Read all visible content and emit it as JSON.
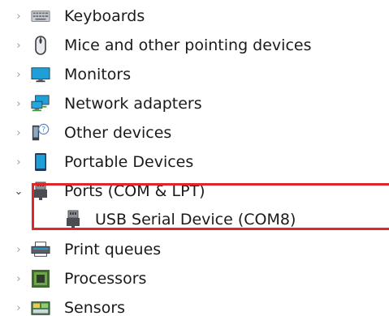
{
  "tree": {
    "items": [
      {
        "label": "Keyboards",
        "icon": "keyboard-icon",
        "toggle": "›",
        "state": "collapsed"
      },
      {
        "label": "Mice and other pointing devices",
        "icon": "mouse-icon",
        "toggle": "›",
        "state": "collapsed"
      },
      {
        "label": "Monitors",
        "icon": "monitor-icon",
        "toggle": "›",
        "state": "collapsed"
      },
      {
        "label": "Network adapters",
        "icon": "network-adapter-icon",
        "toggle": "›",
        "state": "collapsed"
      },
      {
        "label": "Other devices",
        "icon": "unknown-device-icon",
        "toggle": "›",
        "state": "collapsed"
      },
      {
        "label": "Portable Devices",
        "icon": "portable-device-icon",
        "toggle": "›",
        "state": "collapsed"
      },
      {
        "label": "Ports (COM & LPT)",
        "icon": "port-connector-icon",
        "toggle": "⌄",
        "state": "expanded",
        "children": [
          {
            "label": "USB Serial Device (COM8)",
            "icon": "usb-serial-connector-icon"
          }
        ]
      },
      {
        "label": "Print queues",
        "icon": "printer-icon",
        "toggle": "›",
        "state": "collapsed"
      },
      {
        "label": "Processors",
        "icon": "processor-chip-icon",
        "toggle": "›",
        "state": "collapsed"
      },
      {
        "label": "Sensors",
        "icon": "sensor-icon",
        "toggle": "›",
        "state": "collapsed"
      }
    ]
  },
  "colors": {
    "highlight_border": "#e0262d",
    "text": "#1b1b1b",
    "toggle_collapsed": "#9a9a9a"
  }
}
